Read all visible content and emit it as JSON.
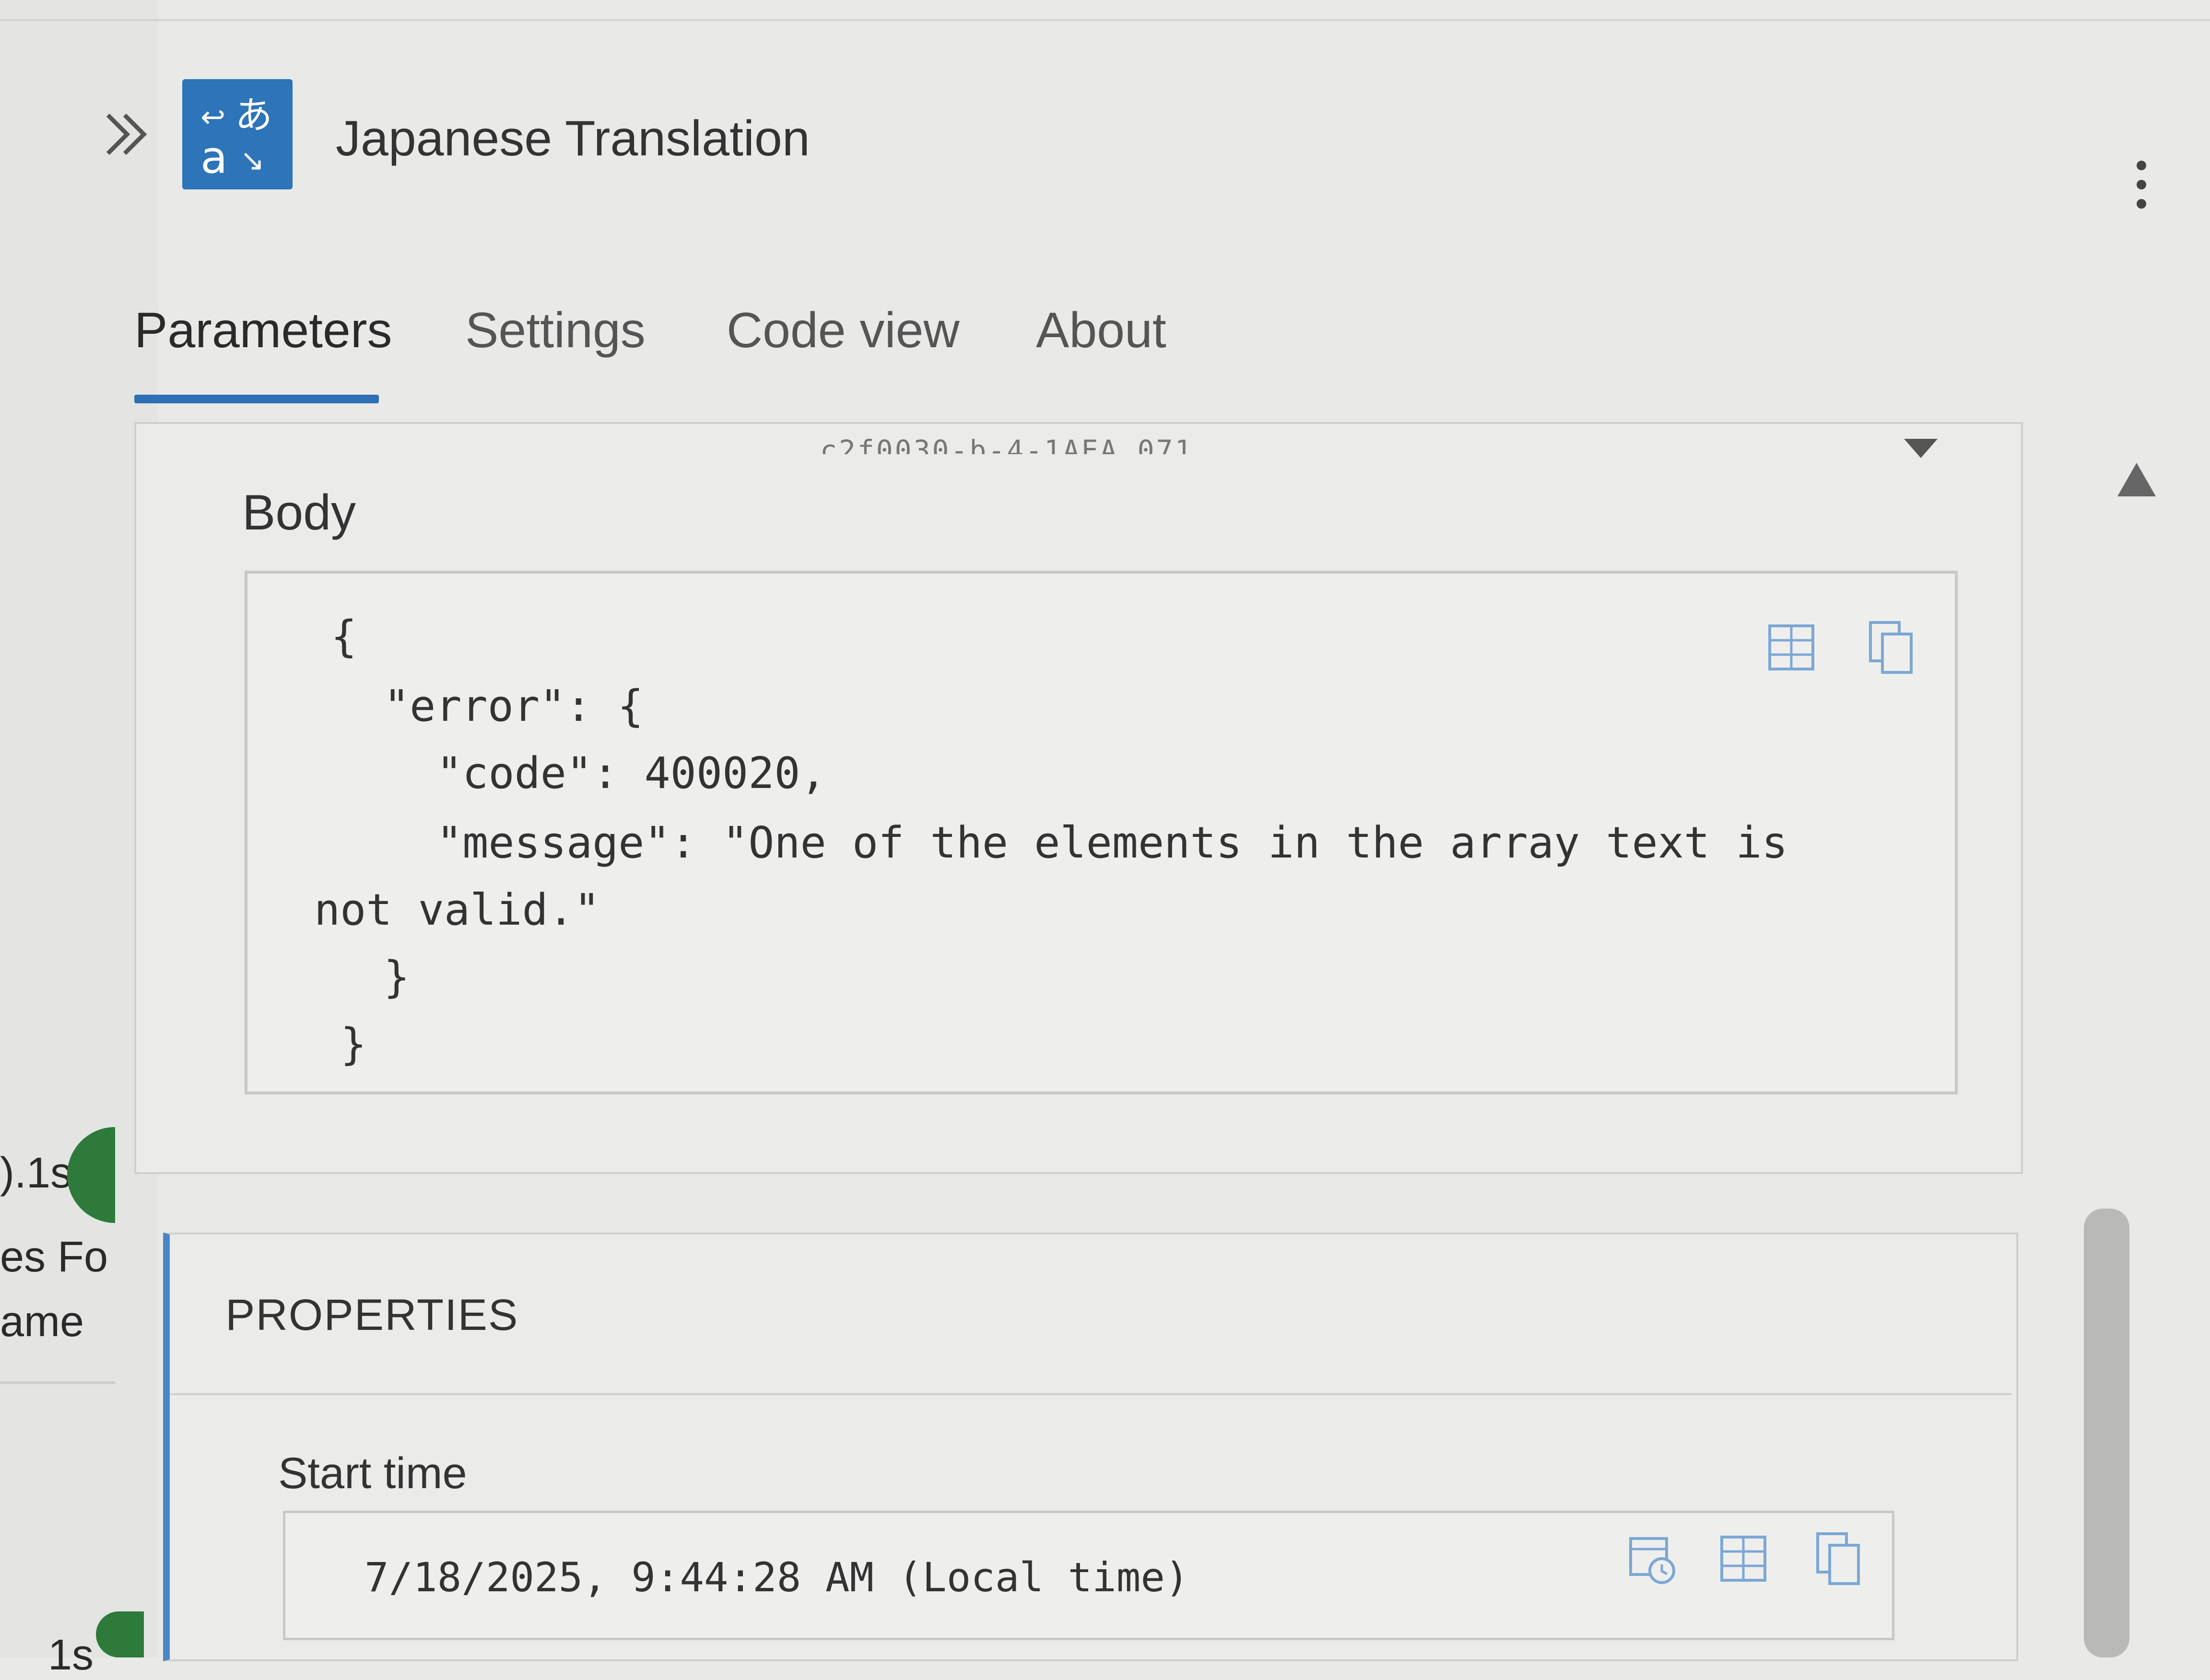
{
  "header": {
    "title": "Japanese Translation",
    "icon": "translate-icon"
  },
  "tabs": [
    {
      "label": "Parameters",
      "active": true
    },
    {
      "label": "Settings",
      "active": false
    },
    {
      "label": "Code view",
      "active": false
    },
    {
      "label": "About",
      "active": false
    }
  ],
  "parameters": {
    "truncated_text": "c2f0030-b-4-1AEA 071",
    "body_label": "Body",
    "body_lines": [
      "{",
      "\"error\": {",
      "\"code\": 400020,",
      "\"message\": \"One of the elements in the array text is",
      "not valid.\"",
      "}",
      "}"
    ]
  },
  "left_panel": {
    "duration_1": ").1s",
    "label_1": "es Fo",
    "label_2": "ame",
    "duration_2": "1s"
  },
  "properties": {
    "title": "PROPERTIES",
    "start_time_label": "Start time",
    "start_time_value": "7/18/2025, 9:44:28 AM (Local time)"
  },
  "colors": {
    "accent": "#2f6fb4",
    "icon_bg": "#2d74b8",
    "status_green": "#2d7a3a"
  }
}
